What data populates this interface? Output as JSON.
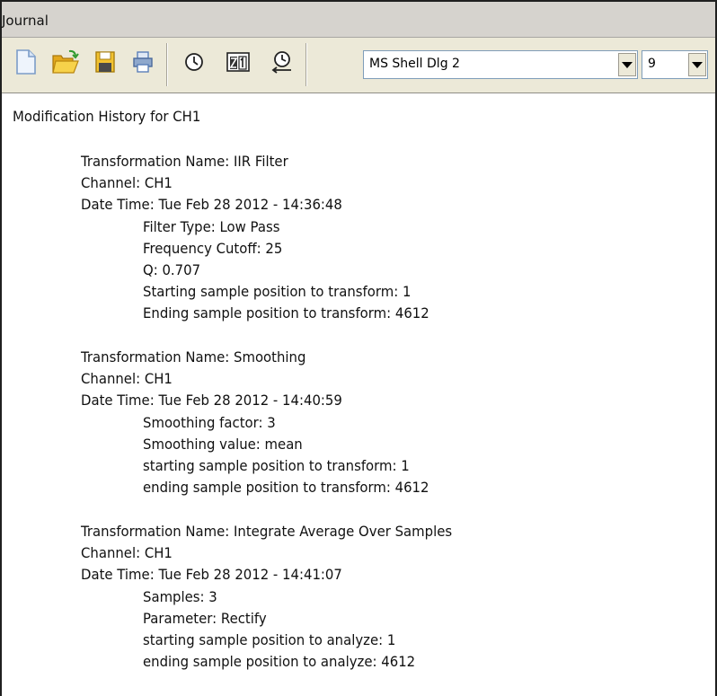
{
  "window": {
    "title": "Journal"
  },
  "toolbar": {
    "buttons": [
      {
        "name": "new-document",
        "icon": "new-document-icon"
      },
      {
        "name": "open-folder",
        "icon": "open-folder-icon"
      },
      {
        "name": "save",
        "icon": "save-icon"
      },
      {
        "name": "print",
        "icon": "printer-icon"
      },
      {
        "name": "history",
        "icon": "clock-icon"
      },
      {
        "name": "sort",
        "icon": "sort-za-icon"
      },
      {
        "name": "restore-history",
        "icon": "clock-restore-icon"
      }
    ],
    "font_name": "MS Shell Dlg 2",
    "font_size": "9",
    "colors": {
      "toolbar_bg": "#ece9d8",
      "icon_yellow": "#f2c230",
      "icon_blue": "#3a6fc4"
    }
  },
  "journal": {
    "heading": "Modification History for CH1",
    "entries": [
      {
        "name": "Transformation Name: IIR Filter",
        "channel": "Channel: CH1",
        "datetime": "Date Time: Tue Feb 28 2012 - 14:36:48",
        "params": [
          "Filter Type: Low Pass",
          "Frequency Cutoff: 25",
          "Q: 0.707",
          "Starting sample position to transform: 1",
          "Ending sample position to transform: 4612"
        ]
      },
      {
        "name": "Transformation Name: Smoothing",
        "channel": "Channel: CH1",
        "datetime": "Date Time: Tue Feb 28 2012 - 14:40:59",
        "params": [
          "Smoothing factor: 3",
          "Smoothing value: mean",
          "starting sample position to transform: 1",
          "ending sample position to transform: 4612"
        ]
      },
      {
        "name": "Transformation Name: Integrate Average Over Samples",
        "channel": "Channel: CH1",
        "datetime": "Date Time: Tue Feb 28 2012 - 14:41:07",
        "params": [
          "Samples: 3",
          "Parameter: Rectify",
          "starting sample position to analyze: 1",
          "ending sample position to analyze: 4612"
        ]
      }
    ]
  }
}
